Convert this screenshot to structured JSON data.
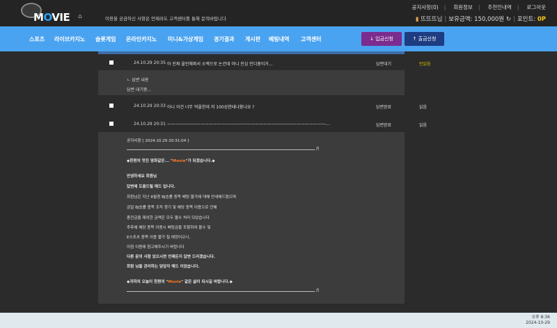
{
  "header": {
    "logo_text": "MOVIE",
    "marquee": "이용을 궁금하신 사항은 언제라도 고객센터를 통해 문의바랍니다",
    "links": [
      "공지사항(0)",
      "회원정보",
      "추천인내역",
      "로그아웃"
    ],
    "user_name": "뜨뜨뜨님",
    "balance_label": "보유금액:",
    "balance_value": "150,000원",
    "point_label": "포인트:",
    "point_value": "0P"
  },
  "nav": {
    "items": [
      "스포츠",
      "라이브카지노",
      "슬롯게임",
      "온라인카지노",
      "미니&가상게임",
      "경기결과",
      "게시판",
      "베팅내역",
      "고객센터"
    ],
    "deposit_label": "↓ 입금신청",
    "withdraw_label": "↑ 출금신청"
  },
  "rows": [
    {
      "date": "24.10.29 20:35",
      "title": "아 진짜 올인해파서 소액으로 논건데 아니 진심 인디충이거...",
      "status": "답변대기",
      "read": "안읽음"
    },
    {
      "date": "24.10.29 20:33",
      "title": "아니 이건 너무 억울한데 저 100상한테나왔나요 ?",
      "status": "답변완료",
      "read": "읽음"
    },
    {
      "date": "24.10.29 20:31",
      "title": "——————————————————————————————————————...",
      "status": "답변완료",
      "read": "읽음"
    }
  ],
  "answer": {
    "label": "ㄴ 답변 내용",
    "text": "답변 대기중..."
  },
  "notice": {
    "header": "공지사항 [ 2024.10.29 20:31:04 ]",
    "note_symbol": "♬",
    "greet_pre": "◆한편의 멋진 영화같은... \"",
    "greet_hl": "Movie",
    "greet_post": "\"가 되겠습니다.◆",
    "lines": [
      "안녕하세요 회원님",
      "답변에 도움드릴 매드 입니다.",
      "회원님은 지난 8월경 BJ승률 종목 배팅 불가에 대해 안내해드렸으며",
      "금일 BJ승률 종목 조작 경기 및 해당 종목 이용으로 인해",
      "충전금을 제외한 금액은 모두 몰수 처리 되었습니다",
      "추후에 해당 종목 이용시 배팅금을 포함하여 몰수 및",
      "E스포츠 종목 이용 불가 될 예정이오니,",
      "이점 이용에 참고해주시기 바랍니다",
      "다른 문의 사항 있으시면 언제든지 답변 드리겠습니다.",
      "회원 님을 관리하는 담당자 매드 이었습니다."
    ],
    "closing_pre": "◆귀하의 오늘이 한편의 \"",
    "closing_hl": "Movie",
    "closing_post": "\" 같은 삶이 되시길 바랍니다.◆"
  },
  "taskbar": {
    "time": "오후 8:36",
    "date": "2024-10-29"
  }
}
